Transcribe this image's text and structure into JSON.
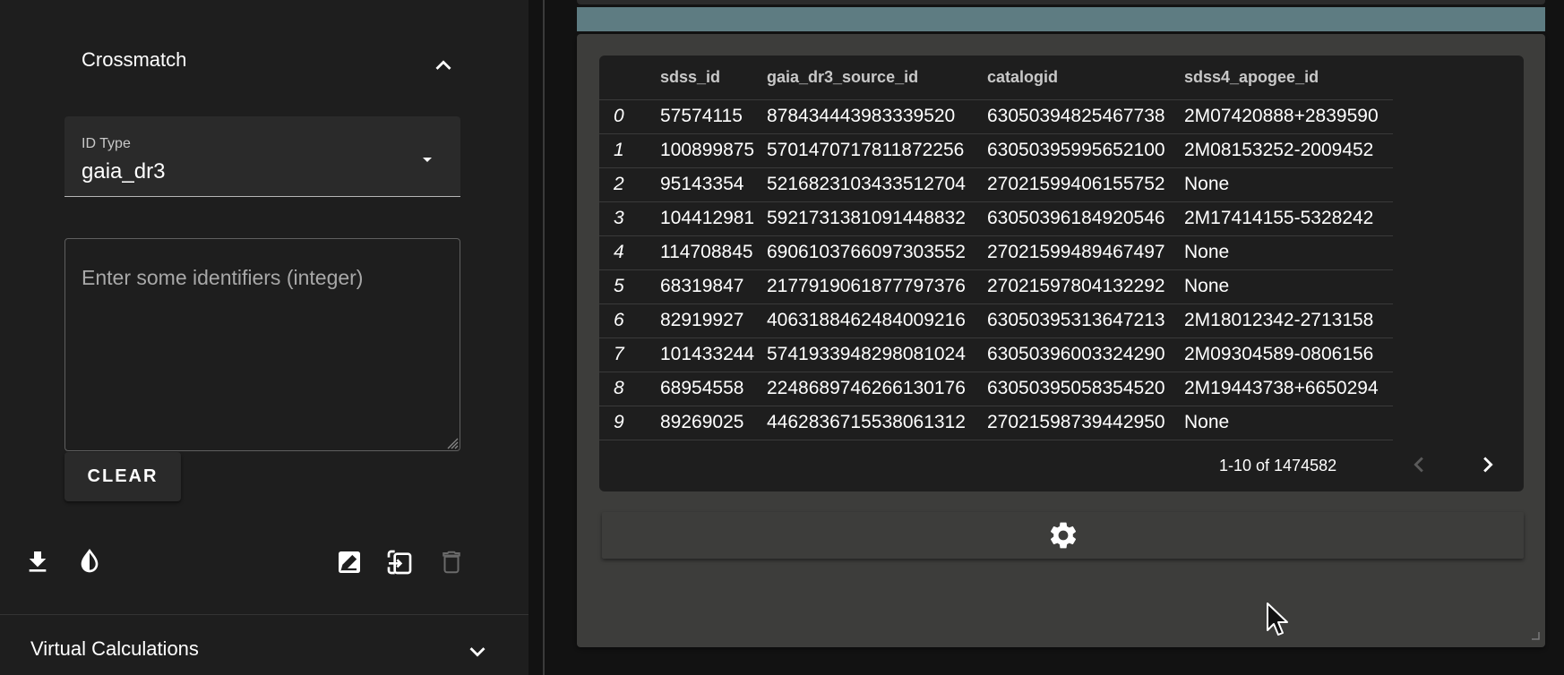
{
  "crossmatch": {
    "title": "Crossmatch",
    "id_type_label": "ID Type",
    "id_type_value": "gaia_dr3",
    "identifiers_placeholder": "Enter some identifiers (integer)",
    "clear_label": "CLEAR"
  },
  "toolbar": {
    "icons": [
      "download-icon",
      "contrast-icon",
      "edit-icon",
      "import-icon",
      "delete-icon"
    ]
  },
  "virtual_calculations": {
    "title": "Virtual Calculations"
  },
  "table": {
    "columns": [
      "",
      "sdss_id",
      "gaia_dr3_source_id",
      "catalogid",
      "sdss4_apogee_id"
    ],
    "rows": [
      [
        "0",
        "57574115",
        "878434443983339520",
        "63050394825467738",
        "2M07420888+2839590"
      ],
      [
        "1",
        "100899875",
        "5701470717811872256",
        "63050395995652100",
        "2M08153252-2009452"
      ],
      [
        "2",
        "95143354",
        "5216823103433512704",
        "27021599406155752",
        "None"
      ],
      [
        "3",
        "104412981",
        "5921731381091448832",
        "63050396184920546",
        "2M17414155-5328242"
      ],
      [
        "4",
        "114708845",
        "6906103766097303552",
        "27021599489467497",
        "None"
      ],
      [
        "5",
        "68319847",
        "2177919061877797376",
        "27021597804132292",
        "None"
      ],
      [
        "6",
        "82919927",
        "4063188462484009216",
        "63050395313647213",
        "2M18012342-2713158"
      ],
      [
        "7",
        "101433244",
        "5741933948298081024",
        "63050396003324290",
        "2M09304589-0806156"
      ],
      [
        "8",
        "68954558",
        "2248689746266130176",
        "63050395058354520",
        "2M19443738+6650294"
      ],
      [
        "9",
        "89269025",
        "4462836715538061312",
        "27021598739442950",
        "None"
      ]
    ],
    "pagination": "1-10 of 1474582"
  },
  "colors": {
    "background": "#121212",
    "panel": "#1e1e1e",
    "card": "#3d3d3b",
    "accent_bar": "#5e7c82"
  }
}
